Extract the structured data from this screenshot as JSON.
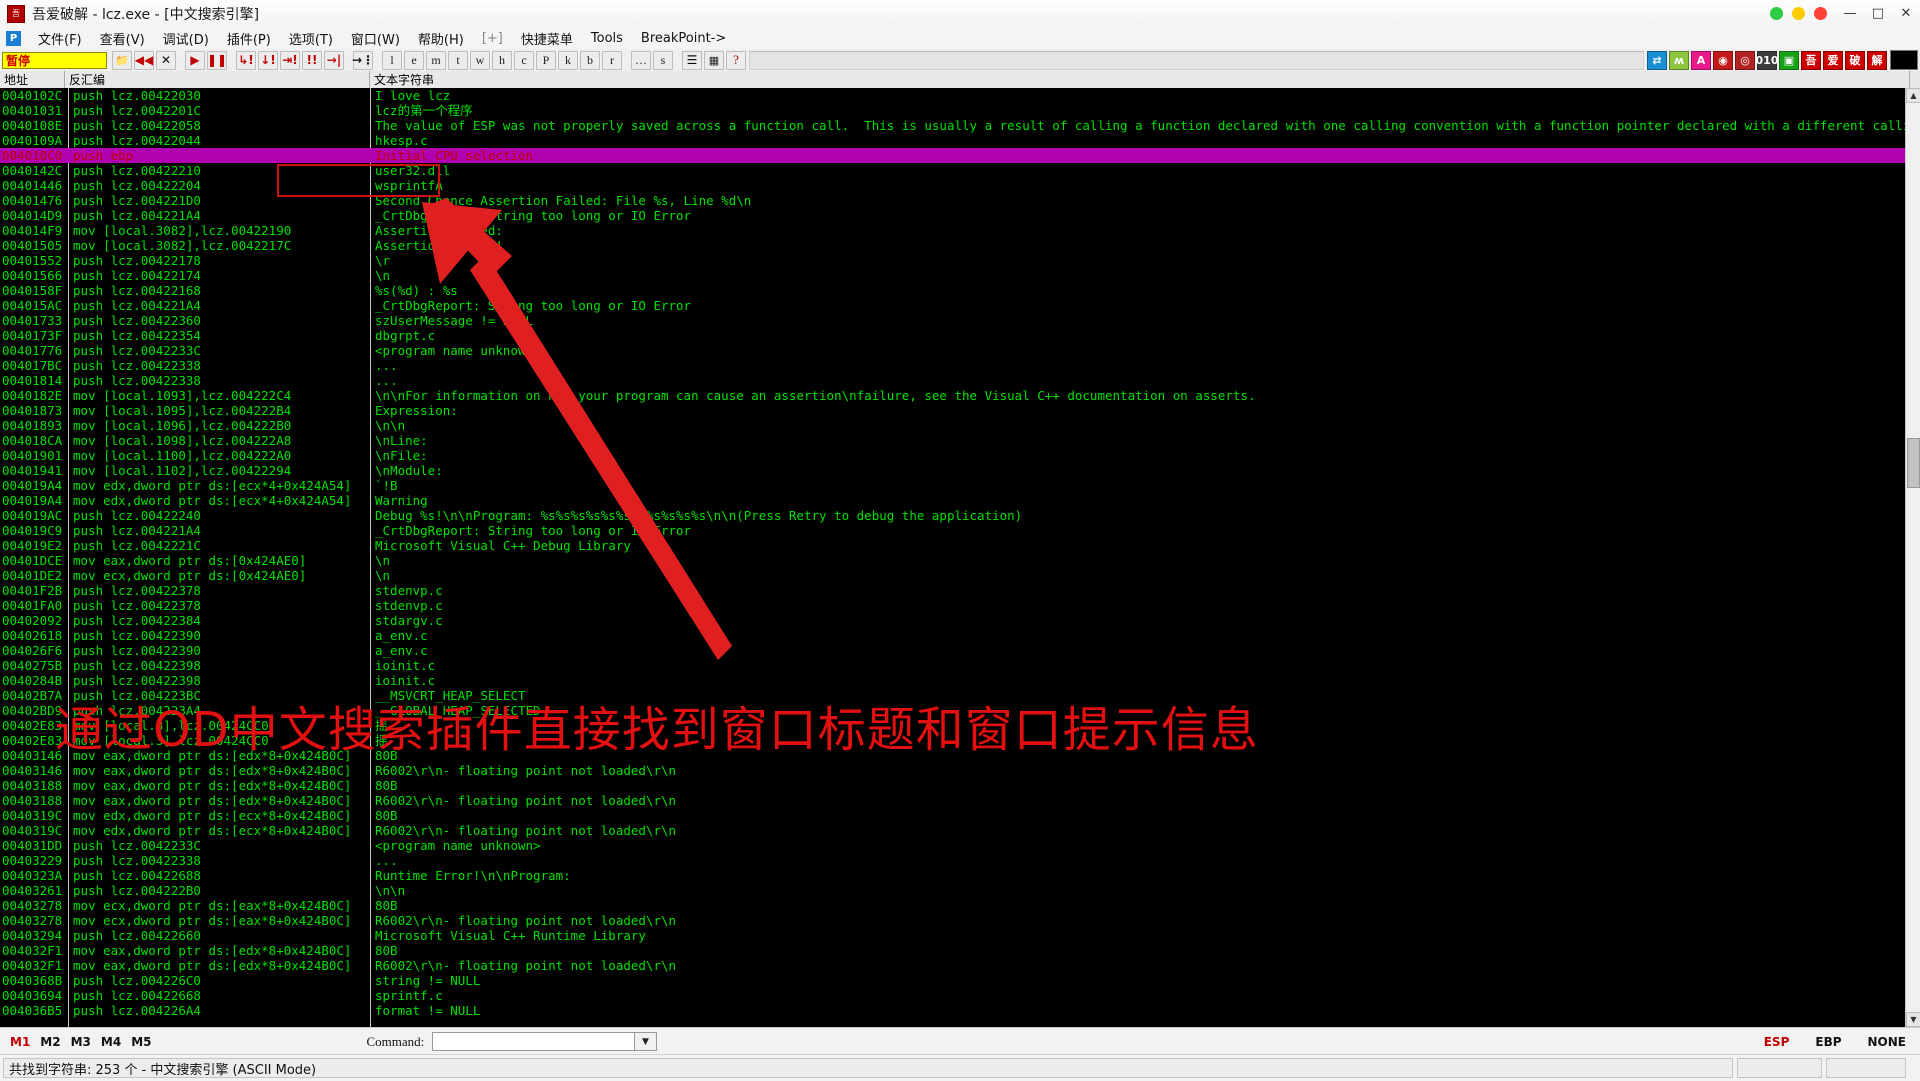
{
  "window": {
    "title": "吾爱破解 - lcz.exe - [中文搜索引擎]",
    "logo_glyph": "吾",
    "minimize": "—",
    "maximize": "□",
    "close": "✕",
    "dots": [
      "#2ecc40",
      "#ffcc00",
      "#ff4136"
    ]
  },
  "menu": {
    "app_icon_glyph": "P",
    "items": [
      {
        "label": "文件(F)",
        "dim": false
      },
      {
        "label": "查看(V)",
        "dim": false
      },
      {
        "label": "调试(D)",
        "dim": false
      },
      {
        "label": "插件(P)",
        "dim": false
      },
      {
        "label": "选项(T)",
        "dim": false
      },
      {
        "label": "窗口(W)",
        "dim": false
      },
      {
        "label": "帮助(H)",
        "dim": false
      },
      {
        "label": "[+]",
        "dim": true
      },
      {
        "label": "快捷菜单",
        "dim": false
      },
      {
        "label": "Tools",
        "dim": false
      },
      {
        "label": "BreakPoint->",
        "dim": false
      }
    ]
  },
  "toolbar": {
    "status_value": "暂停",
    "buttons": [
      {
        "name": "open-file-button",
        "glyph": "📁",
        "kind": "icon"
      },
      {
        "name": "restart-button",
        "glyph": "◀◀",
        "kind": "red"
      },
      {
        "name": "close-program-button",
        "glyph": "✕",
        "kind": "dark"
      },
      {
        "name": "separator",
        "glyph": "",
        "kind": "sep"
      },
      {
        "name": "run-button",
        "glyph": "▶",
        "kind": "red"
      },
      {
        "name": "pause-button",
        "glyph": "❚❚",
        "kind": "red"
      },
      {
        "name": "separator",
        "glyph": "",
        "kind": "sep"
      },
      {
        "name": "step-into-button",
        "glyph": "↳!",
        "kind": "red"
      },
      {
        "name": "step-over-button",
        "glyph": "↓!",
        "kind": "red"
      },
      {
        "name": "trace-into-button",
        "glyph": "⇥!",
        "kind": "red"
      },
      {
        "name": "trace-over-button",
        "glyph": "!!",
        "kind": "red"
      },
      {
        "name": "execute-till-return-button",
        "glyph": "→|",
        "kind": "red"
      },
      {
        "name": "separator",
        "glyph": "",
        "kind": "sep"
      },
      {
        "name": "run-to-selection-button",
        "glyph": "→⋮",
        "kind": "dark"
      },
      {
        "name": "separator",
        "glyph": "",
        "kind": "sep"
      },
      {
        "name": "log-window-button",
        "glyph": "l",
        "kind": "letter"
      },
      {
        "name": "executable-modules-button",
        "glyph": "e",
        "kind": "letter"
      },
      {
        "name": "memory-map-button",
        "glyph": "m",
        "kind": "letter"
      },
      {
        "name": "threads-button",
        "glyph": "t",
        "kind": "letter"
      },
      {
        "name": "windows-button",
        "glyph": "w",
        "kind": "letter"
      },
      {
        "name": "handles-button",
        "glyph": "h",
        "kind": "letter"
      },
      {
        "name": "cpu-window-button",
        "glyph": "c",
        "kind": "letter"
      },
      {
        "name": "patches-button",
        "glyph": "P",
        "kind": "letter"
      },
      {
        "name": "call-stack-button",
        "glyph": "k",
        "kind": "letter"
      },
      {
        "name": "breakpoints-button",
        "glyph": "b",
        "kind": "letter"
      },
      {
        "name": "references-button",
        "glyph": "r",
        "kind": "letter"
      },
      {
        "name": "separator",
        "glyph": "",
        "kind": "sep"
      },
      {
        "name": "run-trace-button",
        "glyph": "…",
        "kind": "letter"
      },
      {
        "name": "source-button",
        "glyph": "s",
        "kind": "letter"
      },
      {
        "name": "separator",
        "glyph": "",
        "kind": "sep"
      },
      {
        "name": "options-list-button",
        "glyph": "☰",
        "kind": "dark"
      },
      {
        "name": "plugin-window-button",
        "glyph": "▦",
        "kind": "icon"
      },
      {
        "name": "help-button",
        "glyph": "?",
        "kind": "q"
      }
    ],
    "color_buttons": [
      {
        "name": "hide-debugger-button",
        "glyph": "⇄",
        "color": "#1a8fd4"
      },
      {
        "name": "strongod-button",
        "glyph": "ʍ",
        "color": "#8ec63f"
      },
      {
        "name": "analyze-button",
        "glyph": "A",
        "color": "#ea1a8c"
      },
      {
        "name": "olly-advanced-button",
        "glyph": "◉",
        "color": "#c41a1a"
      },
      {
        "name": "fingerprint-button",
        "glyph": "◎",
        "color": "#b22222"
      },
      {
        "name": "binary-tool-button",
        "glyph": "010",
        "color": "#3d3d3d"
      },
      {
        "name": "memory-tool-button",
        "glyph": "▣",
        "color": "#17a117"
      },
      {
        "name": "wu-button",
        "glyph": "吾",
        "color": "#cc0000"
      },
      {
        "name": "ai-button",
        "glyph": "爱",
        "color": "#cc0000"
      },
      {
        "name": "po-button",
        "glyph": "破",
        "color": "#cc0000"
      },
      {
        "name": "jie-button",
        "glyph": "解",
        "color": "#cc0000"
      }
    ]
  },
  "columns": {
    "address": "地址",
    "disassembly": "反汇编",
    "text_string": "文本字符串"
  },
  "annotation": {
    "overlay_text": "通过OD中文搜索插件直接找到窗口标题和窗口提示信息",
    "overlay_color": "#e21010",
    "box_color": "#cc1111",
    "arrow_color": "#e02020"
  },
  "rows": [
    {
      "addr": "0040102C",
      "dis": "push lcz.00422030",
      "txt": "I love lcz",
      "sel": false
    },
    {
      "addr": "00401031",
      "dis": "push lcz.0042201C",
      "txt": "lcz的第一个程序",
      "sel": false
    },
    {
      "addr": "0040108E",
      "dis": "push lcz.00422058",
      "txt": "The value of ESP was not properly saved across a function call.  This is usually a result of calling a function declared with one calling convention with a function pointer declared with a different calli",
      "sel": false
    },
    {
      "addr": "0040109A",
      "dis": "push lcz.00422044",
      "txt": "hkesp.c",
      "sel": false
    },
    {
      "addr": "004010C0",
      "dis": "push ebp",
      "txt": "Initial CPU selection",
      "sel": true
    },
    {
      "addr": "0040142C",
      "dis": "push lcz.00422210",
      "txt": "user32.dll",
      "sel": false
    },
    {
      "addr": "00401446",
      "dis": "push lcz.00422204",
      "txt": "wsprintfA",
      "sel": false
    },
    {
      "addr": "00401476",
      "dis": "push lcz.004221D0",
      "txt": "Second Chance Assertion Failed: File %s, Line %d\\n",
      "sel": false
    },
    {
      "addr": "004014D9",
      "dis": "push lcz.004221A4",
      "txt": "_CrtDbgReport: String too long or IO Error",
      "sel": false
    },
    {
      "addr": "004014F9",
      "dis": "mov [local.3082],lcz.00422190",
      "txt": "Assertion failed:",
      "sel": false
    },
    {
      "addr": "00401505",
      "dis": "mov [local.3082],lcz.0042217C",
      "txt": "Assertion failed!",
      "sel": false
    },
    {
      "addr": "00401552",
      "dis": "push lcz.00422178",
      "txt": "\\r",
      "sel": false
    },
    {
      "addr": "00401566",
      "dis": "push lcz.00422174",
      "txt": "\\n",
      "sel": false
    },
    {
      "addr": "0040158F",
      "dis": "push lcz.00422168",
      "txt": "%s(%d) : %s",
      "sel": false
    },
    {
      "addr": "004015AC",
      "dis": "push lcz.004221A4",
      "txt": "_CrtDbgReport: String too long or IO Error",
      "sel": false
    },
    {
      "addr": "00401733",
      "dis": "push lcz.00422360",
      "txt": "szUserMessage != NULL",
      "sel": false
    },
    {
      "addr": "0040173F",
      "dis": "push lcz.00422354",
      "txt": "dbgrpt.c",
      "sel": false
    },
    {
      "addr": "00401776",
      "dis": "push lcz.0042233C",
      "txt": "<program name unknown>",
      "sel": false
    },
    {
      "addr": "004017BC",
      "dis": "push lcz.00422338",
      "txt": "...",
      "sel": false
    },
    {
      "addr": "00401814",
      "dis": "push lcz.00422338",
      "txt": "...",
      "sel": false
    },
    {
      "addr": "0040182E",
      "dis": "mov [local.1093],lcz.004222C4",
      "txt": "\\n\\nFor information on how your program can cause an assertion\\nfailure, see the Visual C++ documentation on asserts.",
      "sel": false
    },
    {
      "addr": "00401873",
      "dis": "mov [local.1095],lcz.004222B4",
      "txt": "Expression:",
      "sel": false
    },
    {
      "addr": "00401893",
      "dis": "mov [local.1096],lcz.004222B0",
      "txt": "\\n\\n",
      "sel": false
    },
    {
      "addr": "004018CA",
      "dis": "mov [local.1098],lcz.004222A8",
      "txt": "\\nLine:",
      "sel": false
    },
    {
      "addr": "00401901",
      "dis": "mov [local.1100],lcz.004222A0",
      "txt": "\\nFile:",
      "sel": false
    },
    {
      "addr": "00401941",
      "dis": "mov [local.1102],lcz.00422294",
      "txt": "\\nModule:",
      "sel": false
    },
    {
      "addr": "004019A4",
      "dis": "mov edx,dword ptr ds:[ecx*4+0x424A54]",
      "txt": "`!B",
      "sel": false
    },
    {
      "addr": "004019A4",
      "dis": "mov edx,dword ptr ds:[ecx*4+0x424A54]",
      "txt": "Warning",
      "sel": false
    },
    {
      "addr": "004019AC",
      "dis": "push lcz.00422240",
      "txt": "Debug %s!\\n\\nProgram: %s%s%s%s%s%s%s%s%s%s%s\\n\\n(Press Retry to debug the application)",
      "sel": false
    },
    {
      "addr": "004019C9",
      "dis": "push lcz.004221A4",
      "txt": "_CrtDbgReport: String too long or IO Error",
      "sel": false
    },
    {
      "addr": "004019E2",
      "dis": "push lcz.0042221C",
      "txt": "Microsoft Visual C++ Debug Library",
      "sel": false
    },
    {
      "addr": "00401DCE",
      "dis": "mov eax,dword ptr ds:[0x424AE0]",
      "txt": "\\n",
      "sel": false
    },
    {
      "addr": "00401DE2",
      "dis": "mov ecx,dword ptr ds:[0x424AE0]",
      "txt": "\\n",
      "sel": false
    },
    {
      "addr": "00401F2B",
      "dis": "push lcz.00422378",
      "txt": "stdenvp.c",
      "sel": false
    },
    {
      "addr": "00401FA0",
      "dis": "push lcz.00422378",
      "txt": "stdenvp.c",
      "sel": false
    },
    {
      "addr": "00402092",
      "dis": "push lcz.00422384",
      "txt": "stdargv.c",
      "sel": false
    },
    {
      "addr": "00402618",
      "dis": "push lcz.00422390",
      "txt": "a_env.c",
      "sel": false
    },
    {
      "addr": "004026F6",
      "dis": "push lcz.00422390",
      "txt": "a_env.c",
      "sel": false
    },
    {
      "addr": "0040275B",
      "dis": "push lcz.00422398",
      "txt": "ioinit.c",
      "sel": false
    },
    {
      "addr": "0040284B",
      "dis": "push lcz.00422398",
      "txt": "ioinit.c",
      "sel": false
    },
    {
      "addr": "00402B7A",
      "dis": "push lcz.004223BC",
      "txt": "__MSVCRT_HEAP_SELECT",
      "sel": false
    },
    {
      "addr": "00402BD9",
      "dis": "push lcz.004223A4",
      "txt": "__GLOBAL_HEAP_SELECTED",
      "sel": false
    },
    {
      "addr": "00402E83",
      "dis": "mov [local.3],lcz.00424CC0",
      "txt": "摇",
      "sel": false
    },
    {
      "addr": "00402E83",
      "dis": "mov [local.3],lcz.00424CC0",
      "txt": "摇",
      "sel": false
    },
    {
      "addr": "00403146",
      "dis": "mov eax,dword ptr ds:[edx*8+0x424B0C]",
      "txt": "80B",
      "sel": false
    },
    {
      "addr": "00403146",
      "dis": "mov eax,dword ptr ds:[edx*8+0x424B0C]",
      "txt": "R6002\\r\\n- floating point not loaded\\r\\n",
      "sel": false
    },
    {
      "addr": "00403188",
      "dis": "mov eax,dword ptr ds:[edx*8+0x424B0C]",
      "txt": "80B",
      "sel": false
    },
    {
      "addr": "00403188",
      "dis": "mov eax,dword ptr ds:[edx*8+0x424B0C]",
      "txt": "R6002\\r\\n- floating point not loaded\\r\\n",
      "sel": false
    },
    {
      "addr": "0040319C",
      "dis": "mov edx,dword ptr ds:[ecx*8+0x424B0C]",
      "txt": "80B",
      "sel": false
    },
    {
      "addr": "0040319C",
      "dis": "mov edx,dword ptr ds:[ecx*8+0x424B0C]",
      "txt": "R6002\\r\\n- floating point not loaded\\r\\n",
      "sel": false
    },
    {
      "addr": "004031DD",
      "dis": "push lcz.0042233C",
      "txt": "<program name unknown>",
      "sel": false
    },
    {
      "addr": "00403229",
      "dis": "push lcz.00422338",
      "txt": "...",
      "sel": false
    },
    {
      "addr": "0040323A",
      "dis": "push lcz.00422688",
      "txt": "Runtime Error!\\n\\nProgram: ",
      "sel": false
    },
    {
      "addr": "00403261",
      "dis": "push lcz.004222B0",
      "txt": "\\n\\n",
      "sel": false
    },
    {
      "addr": "00403278",
      "dis": "mov ecx,dword ptr ds:[eax*8+0x424B0C]",
      "txt": "80B",
      "sel": false
    },
    {
      "addr": "00403278",
      "dis": "mov ecx,dword ptr ds:[eax*8+0x424B0C]",
      "txt": "R6002\\r\\n- floating point not loaded\\r\\n",
      "sel": false
    },
    {
      "addr": "00403294",
      "dis": "push lcz.00422660",
      "txt": "Microsoft Visual C++ Runtime Library",
      "sel": false
    },
    {
      "addr": "004032F1",
      "dis": "mov eax,dword ptr ds:[edx*8+0x424B0C]",
      "txt": "80B",
      "sel": false
    },
    {
      "addr": "004032F1",
      "dis": "mov eax,dword ptr ds:[edx*8+0x424B0C]",
      "txt": "R6002\\r\\n- floating point not loaded\\r\\n",
      "sel": false
    },
    {
      "addr": "0040368B",
      "dis": "push lcz.004226C0",
      "txt": "string != NULL",
      "sel": false
    },
    {
      "addr": "00403694",
      "dis": "push lcz.00422668",
      "txt": "sprintf.c",
      "sel": false
    },
    {
      "addr": "004036B5",
      "dis": "push lcz.004226A4",
      "txt": "format != NULL",
      "sel": false
    }
  ],
  "scrollbar": {
    "up_glyph": "▲",
    "down_glyph": "▼"
  },
  "command_bar": {
    "marks": [
      "M1",
      "M2",
      "M3",
      "M4",
      "M5"
    ],
    "active_mark": "M1",
    "command_label": "Command:",
    "command_value": "",
    "command_placeholder": "",
    "dropdown_glyph": "▼",
    "registers": [
      "ESP",
      "EBP",
      "NONE"
    ],
    "highlight_register": "ESP"
  },
  "status_bar": {
    "message": "共找到字符串: 253 个  -  中文搜索引擎 (ASCII Mode)",
    "right_cell_1": "",
    "right_cell_2": ""
  }
}
